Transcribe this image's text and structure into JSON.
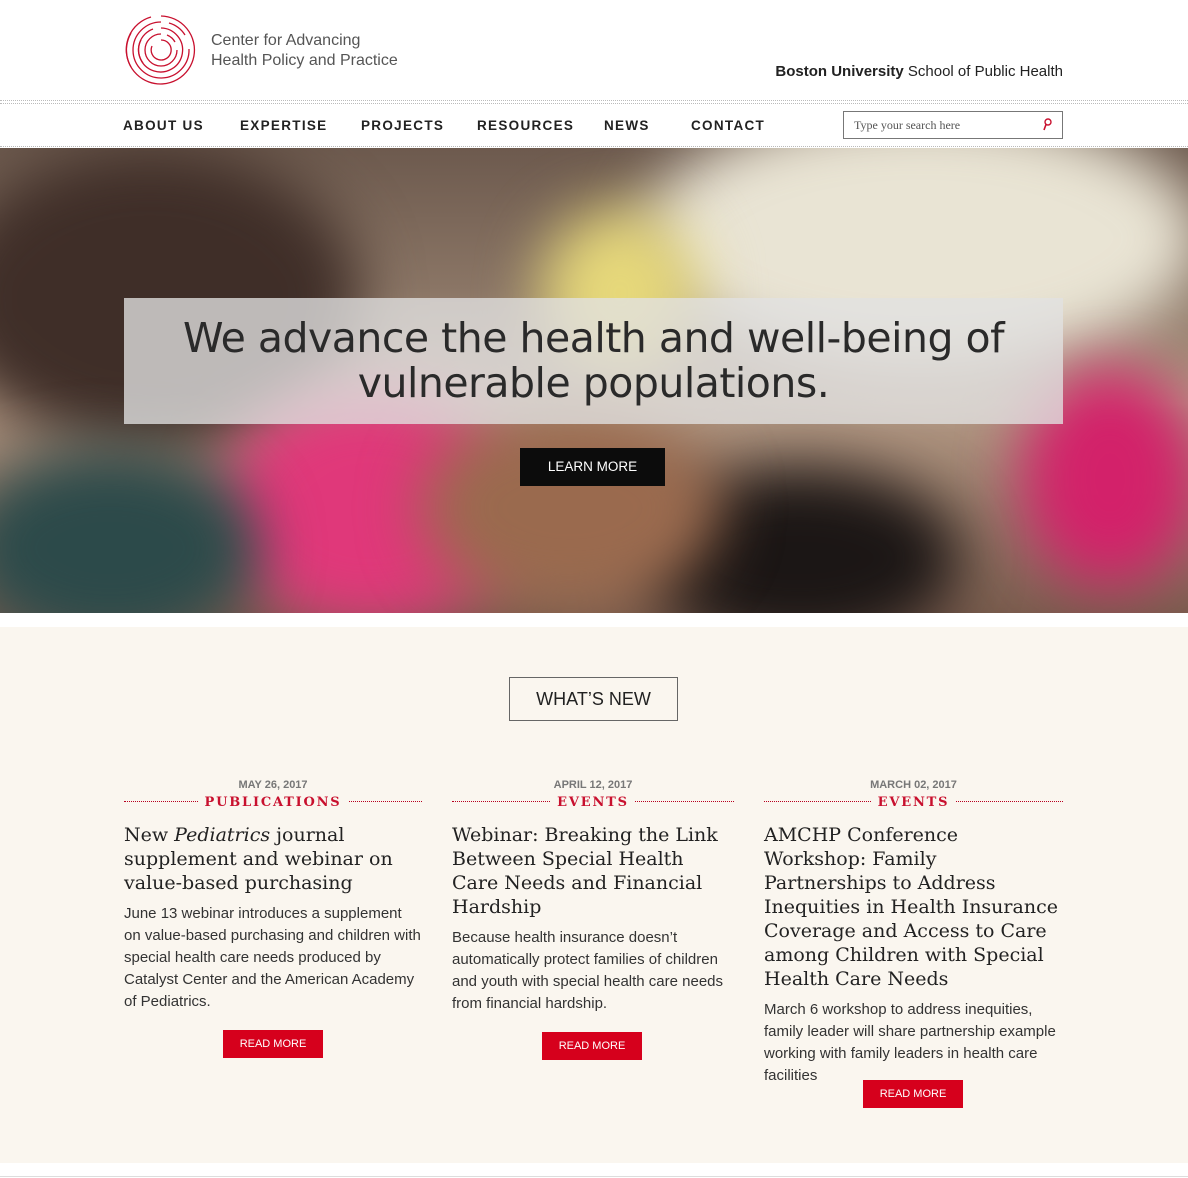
{
  "header": {
    "logo_line1": "Center for Advancing",
    "logo_line2": "Health Policy and Practice",
    "university_bold": "Boston University",
    "university_rest": " School of Public Health"
  },
  "nav": {
    "items": [
      "ABOUT US",
      "EXPERTISE",
      "PROJECTS",
      "RESOURCES",
      "NEWS",
      "CONTACT"
    ],
    "search_placeholder": "Type your search here"
  },
  "hero": {
    "line1": "We advance the health and well-being of",
    "line2": "vulnerable populations.",
    "button": "LEARN MORE"
  },
  "whats_new": {
    "heading": "WHAT’S NEW",
    "cards": [
      {
        "date": "MAY 26, 2017",
        "category": "PUBLICATIONS",
        "title_pre": "New ",
        "title_italic": "Pediatrics",
        "title_post": " journal supplement and webinar on value-based purchasing",
        "text": "June 13 webinar introduces a supplement on value-based purchasing and children with special health care needs produced by Catalyst Center and the American Academy of Pediatrics.",
        "button": "READ MORE"
      },
      {
        "date": "APRIL 12, 2017",
        "category": "EVENTS",
        "title": "Webinar: Breaking the Link Between Special Health Care Needs and Financial Hardship",
        "text": "Because health insurance doesn’t automatically protect families of children and youth with special health care needs from financial hardship.",
        "button": "READ MORE"
      },
      {
        "date": "MARCH 02, 2017",
        "category": "EVENTS",
        "title": "AMCHP Conference Workshop: Family Partnerships to Address Inequities in Health Insurance Coverage and Access to Care among Children with Special Health Care Needs",
        "text": "March 6 workshop to address inequities, family leader will share partnership example working with family leaders in health care facilities",
        "button": "READ MORE"
      }
    ]
  },
  "colors": {
    "accent_red": "#c8102e",
    "button_red": "#d6001c",
    "section_bg": "#faf6ef"
  },
  "icons": {
    "logo": "concentric-circles-logo",
    "search": "search-icon"
  }
}
